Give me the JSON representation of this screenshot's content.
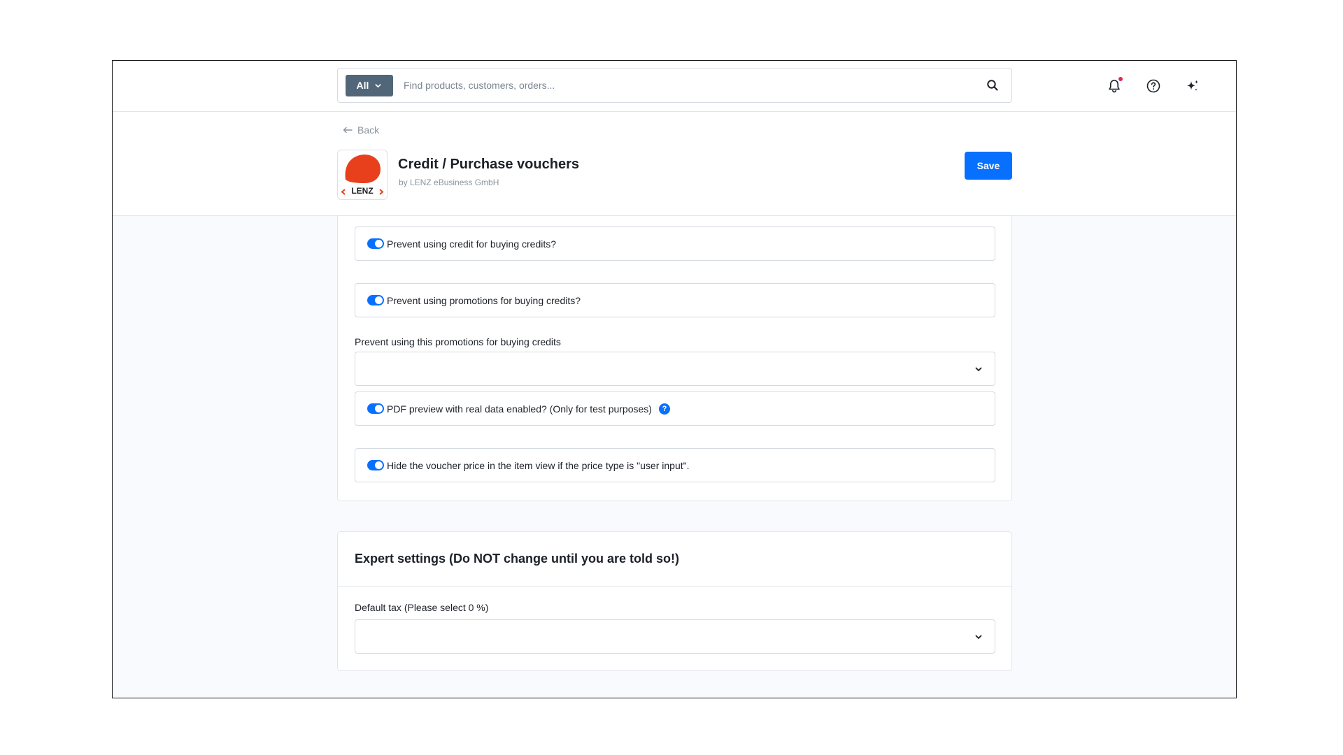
{
  "topbar": {
    "search_scope": "All",
    "search_placeholder": "Find products, customers, orders...",
    "search_value": ""
  },
  "header": {
    "back_label": "Back",
    "app_title": "Credit / Purchase vouchers",
    "app_vendor": "by LENZ eBusiness GmbH",
    "logo_text": "LENZ",
    "save_label": "Save"
  },
  "settings": {
    "toggles": [
      {
        "label": "Prevent using credit for buying credits?",
        "enabled": true
      },
      {
        "label": "Prevent using promotions for buying credits?",
        "enabled": true
      },
      {
        "label": "PDF preview with real data enabled? (Only for test purposes)",
        "enabled": true,
        "has_help": true
      },
      {
        "label": "Hide the voucher price in the item view if the price type is \"user input\".",
        "enabled": true
      }
    ],
    "promotions_select": {
      "label": "Prevent using this promotions for buying credits",
      "value": ""
    }
  },
  "expert": {
    "title": "Expert settings (Do NOT change until you are told so!)",
    "default_tax": {
      "label": "Default tax (Please select 0 %)",
      "value": ""
    }
  },
  "icons": {
    "search": "search-icon",
    "notifications": "bell-icon",
    "help": "question-circle-icon",
    "ai": "sparkles-icon",
    "help_badge": "?"
  },
  "colors": {
    "primary": "#0870ff",
    "scope_button": "#52667a",
    "notification_dot": "#de294c",
    "logo_red": "#e8401c"
  }
}
